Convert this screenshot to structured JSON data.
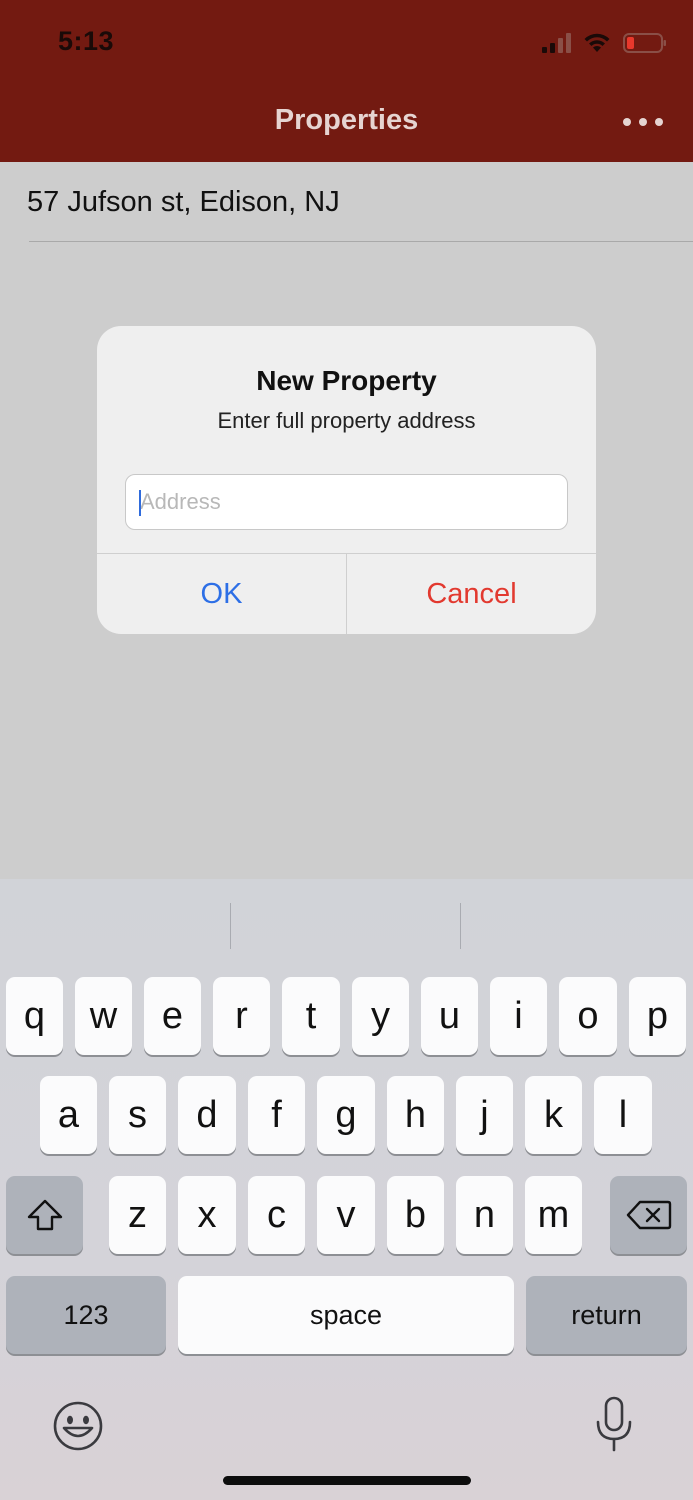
{
  "status_bar": {
    "time": "5:13",
    "signal_icon": "cellular-signal-icon",
    "wifi_icon": "wifi-icon",
    "battery_icon": "battery-low-icon",
    "battery_color": "#e8382c"
  },
  "nav": {
    "title": "Properties",
    "more_icon": "more-horizontal-icon",
    "bar_color": "#731a11"
  },
  "properties": [
    {
      "address": "57 Jufson st, Edison, NJ"
    }
  ],
  "alert": {
    "title": "New Property",
    "message": "Enter full property address",
    "input": {
      "value": "",
      "placeholder": "Address"
    },
    "ok_label": "OK",
    "cancel_label": "Cancel",
    "ok_color": "#2d6fe6",
    "cancel_color": "#e2392f"
  },
  "keyboard": {
    "row1": [
      "q",
      "w",
      "e",
      "r",
      "t",
      "y",
      "u",
      "i",
      "o",
      "p"
    ],
    "row2": [
      "a",
      "s",
      "d",
      "f",
      "g",
      "h",
      "j",
      "k",
      "l"
    ],
    "row3": [
      "z",
      "x",
      "c",
      "v",
      "b",
      "n",
      "m"
    ],
    "shift_icon": "shift-icon",
    "delete_icon": "backspace-icon",
    "numbers_label": "123",
    "space_label": "space",
    "return_label": "return",
    "emoji_icon": "emoji-icon",
    "mic_icon": "microphone-icon"
  }
}
